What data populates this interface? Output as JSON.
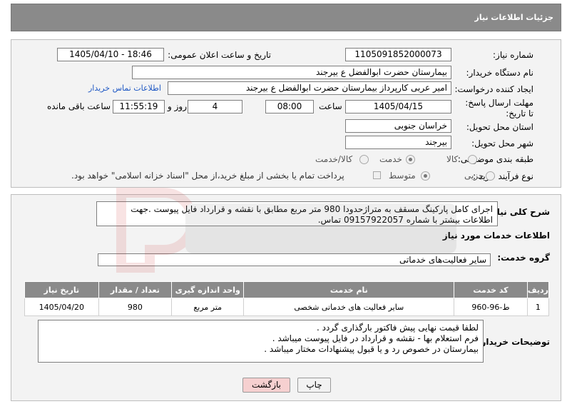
{
  "header": {
    "title": "جزئیات اطلاعات نیاز"
  },
  "info": {
    "need_number_label": "شماره نیاز:",
    "need_number_value": "1105091852000073",
    "announce_label": "تاریخ و ساعت اعلان عمومی:",
    "announce_value": "1405/04/10 - 18:46",
    "buyer_label": "نام دستگاه خریدار:",
    "buyer_value": "بیمارستان حضرت ابوالفضل  ع  بیرجند",
    "creator_label": "ایجاد کننده درخواست:",
    "creator_value": "امیر عربی کارپرداز بیمارستان حضرت ابوالفضل  ع  بیرجند",
    "contact_link": "اطلاعات تماس خریدار",
    "deadline_label": "مهلت ارسال پاسخ: تا تاریخ:",
    "deadline_date": "1405/04/15",
    "time_label": "ساعت",
    "deadline_time": "08:00",
    "days_value": "4",
    "days_label": "روز و",
    "remaining_time": "11:55:19",
    "remaining_label": "ساعت باقی مانده",
    "province_label": "استان محل تحویل:",
    "province_value": "خراسان جنوبی",
    "city_label": "شهر محل تحویل:",
    "city_value": "بیرجند",
    "category_label": "طبقه بندی موضوعی:",
    "category_options": [
      "کالا",
      "خدمت",
      "کالا/خدمت"
    ],
    "category_selected": "خدمت",
    "purchase_label": "نوع فرآیند خرید :",
    "purchase_options": [
      "جزیی",
      "متوسط"
    ],
    "purchase_selected": "متوسط",
    "payment_note": "پرداخت تمام یا بخشی از مبلغ خرید،از محل \"اسناد خزانه اسلامی\" خواهد بود."
  },
  "summary": {
    "label": "شرح کلی نیاز:",
    "text": "اجرای کامل پارکینگ مسقف به متراژحدودا 980 متر مربع مطابق با نقشه و قرارداد فایل پیوست .جهت اطلاعات بیشتر با شماره 09157922057 تماس."
  },
  "services": {
    "section_title": "اطلاعات خدمات مورد نیاز",
    "group_label": "گروه خدمت:",
    "group_value": "سایر فعالیت‌های خدماتی",
    "columns": [
      "ردیف",
      "کد خدمت",
      "نام خدمت",
      "واحد اندازه گیری",
      "تعداد / مقدار",
      "تاریخ نیاز"
    ],
    "rows": [
      {
        "row": "1",
        "code": "ط-96-960",
        "name": "سایر فعالیت های خدماتی شخصی",
        "unit": "متر مربع",
        "qty": "980",
        "date": "1405/04/20"
      }
    ]
  },
  "buyer_notes": {
    "label": "توضیحات خریدار:",
    "lines": [
      "لطفا قیمت نهایی پیش فاکتور بارگذاری گردد .",
      "فرم استعلام بها - نقشه و قرارداد در فایل پیوست میباشد .",
      "بیمارستان در خصوص رد و یا قبول پیشنهادات مختار میباشد ."
    ]
  },
  "buttons": {
    "print": "چاپ",
    "back": "بازگشت"
  },
  "colors": {
    "header_bg": "#8a8a8a",
    "link": "#1f58c4",
    "back_button_bg": "#f6d0d0"
  }
}
